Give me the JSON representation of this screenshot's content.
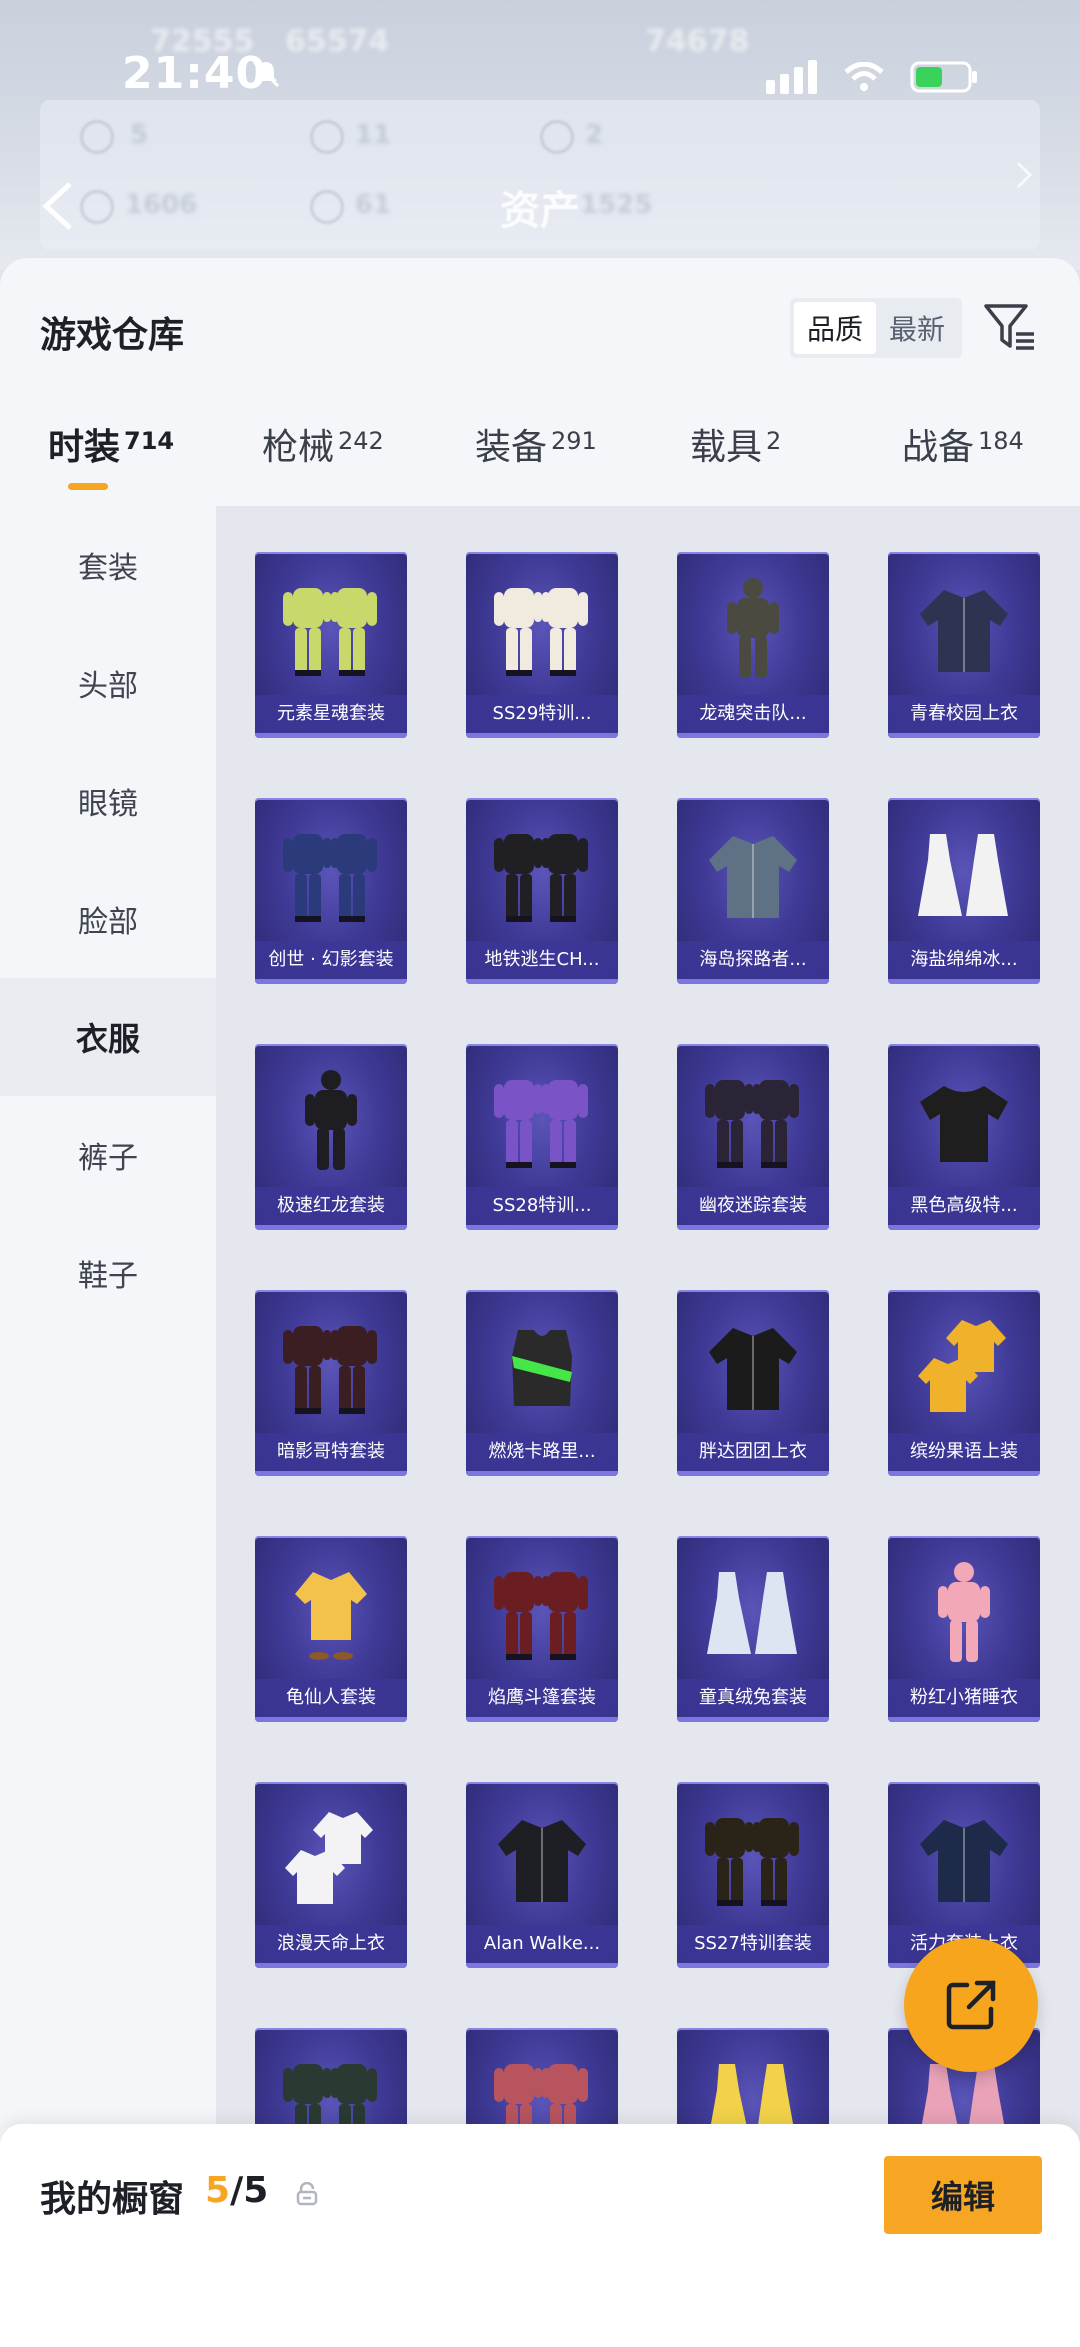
{
  "status_bar": {
    "time": "21:40"
  },
  "background": {
    "title": "资产",
    "ghost_values": [
      "72555",
      "65574",
      "74678",
      "5",
      "11",
      "2",
      "1606",
      "61",
      "1525"
    ]
  },
  "warehouse": {
    "title": "游戏仓库",
    "sort_options": [
      {
        "label": "品质",
        "active": true
      },
      {
        "label": "最新",
        "active": false
      }
    ]
  },
  "tabs": [
    {
      "label": "时装",
      "count": "714",
      "active": true
    },
    {
      "label": "枪械",
      "count": "242",
      "active": false
    },
    {
      "label": "装备",
      "count": "291",
      "active": false
    },
    {
      "label": "载具",
      "count": "2",
      "active": false
    },
    {
      "label": "战备",
      "count": "184",
      "active": false
    }
  ],
  "sidebar": {
    "items": [
      {
        "label": "套装",
        "active": false
      },
      {
        "label": "头部",
        "active": false
      },
      {
        "label": "眼镜",
        "active": false
      },
      {
        "label": "脸部",
        "active": false
      },
      {
        "label": "衣服",
        "active": true
      },
      {
        "label": "裤子",
        "active": false
      },
      {
        "label": "鞋子",
        "active": false
      }
    ]
  },
  "items": [
    {
      "name": "元素星魂套装",
      "icon": "outfit-pair",
      "color": "#c9d86a"
    },
    {
      "name": "SS29特训...",
      "icon": "outfit-pair",
      "color": "#f0eadf"
    },
    {
      "name": "龙魂突击队...",
      "icon": "soldier",
      "color": "#4a4a40"
    },
    {
      "name": "青春校园上衣",
      "icon": "jacket",
      "color": "#2d3350"
    },
    {
      "name": "创世 · 幻影套装",
      "icon": "outfit-pair",
      "color": "#2a3a7a"
    },
    {
      "name": "地铁逃生CH...",
      "icon": "outfit-pair",
      "color": "#1f1f24"
    },
    {
      "name": "海岛探路者...",
      "icon": "jacket",
      "color": "#5f7185"
    },
    {
      "name": "海盐绵绵冰...",
      "icon": "dress",
      "color": "#f2f2f2"
    },
    {
      "name": "极速红龙套装",
      "icon": "soldier",
      "color": "#1e1e22"
    },
    {
      "name": "SS28特训...",
      "icon": "outfit-pair",
      "color": "#7a54c6"
    },
    {
      "name": "幽夜迷踪套装",
      "icon": "outfit-pair",
      "color": "#2a2436"
    },
    {
      "name": "黑色高级特...",
      "icon": "tshirt",
      "color": "#1e1e1e"
    },
    {
      "name": "暗影哥特套装",
      "icon": "outfit-pair",
      "color": "#3a1e22"
    },
    {
      "name": "燃烧卡路里...",
      "icon": "vest",
      "color": "#2a2a2a"
    },
    {
      "name": "胖达团团上衣",
      "icon": "jacket",
      "color": "#1b1b1b"
    },
    {
      "name": "缤纷果语上装",
      "icon": "shirt-pair",
      "color": "#f0b22a"
    },
    {
      "name": "龟仙人套装",
      "icon": "shirt",
      "color": "#f2c24a"
    },
    {
      "name": "焰鹰斗篷套装",
      "icon": "outfit-pair",
      "color": "#6a1e22"
    },
    {
      "name": "童真绒兔套装",
      "icon": "dress",
      "color": "#dce6f2"
    },
    {
      "name": "粉红小猪睡衣",
      "icon": "soldier",
      "color": "#f3a8b8"
    },
    {
      "name": "浪漫天命上衣",
      "icon": "shirt-pair",
      "color": "#f3f3f6"
    },
    {
      "name": "Alan Walke...",
      "icon": "jacket",
      "color": "#1e1f24"
    },
    {
      "name": "SS27特训套装",
      "icon": "outfit-pair",
      "color": "#2a2418"
    },
    {
      "name": "活力套装上衣",
      "icon": "jacket",
      "color": "#1e2a4a"
    },
    {
      "name": "",
      "icon": "outfit-pair",
      "color": "#2a3a32"
    },
    {
      "name": "",
      "icon": "outfit-pair",
      "color": "#b8545e"
    },
    {
      "name": "",
      "icon": "dress",
      "color": "#f2d24a"
    },
    {
      "name": "",
      "icon": "dress",
      "color": "#e9a2b8"
    }
  ],
  "showcase": {
    "label": "我的橱窗",
    "current": "5",
    "total": "/5",
    "edit_label": "编辑"
  },
  "colors": {
    "accent": "#f6a623",
    "card_bg": "#3f3a96",
    "card_label_bg": "#3c3696"
  }
}
